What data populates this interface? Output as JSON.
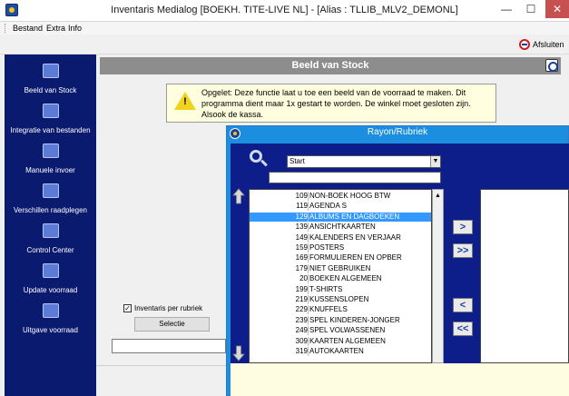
{
  "window": {
    "title": "Inventaris Medialog [BOEKH. TITE-LIVE NL] - [Alias : TLLIB_MLV2_DEMONL]",
    "minimize": "—",
    "maximize": "☐",
    "close": "✕"
  },
  "menu": {
    "items": [
      "Bestand",
      "Extra",
      "Info"
    ]
  },
  "toolbar": {
    "afsluiten_label": "Afsluiten"
  },
  "sidebar": {
    "items": [
      {
        "label": "Beeld van Stock",
        "icon": "camera-icon"
      },
      {
        "label": "Integratie van bestanden",
        "icon": "import-icon"
      },
      {
        "label": "Manuele invoer",
        "icon": "keyboard-icon"
      },
      {
        "label": "Verschillen raadplegen",
        "icon": "compare-icon"
      },
      {
        "label": "Control Center",
        "icon": "control-center-icon"
      },
      {
        "label": "Update voorraad",
        "icon": "update-icon"
      },
      {
        "label": "Uitgave voorraad",
        "icon": "print-icon"
      }
    ]
  },
  "panel": {
    "title": "Beeld van Stock",
    "warning_text": "Opgelet: Deze functie laat u toe een beeld van de voorraad te maken. Dit programma dient maar 1x gestart te worden.  De winkel moet gesloten zijn.  Alsook de kassa.",
    "checkbox_label": "Inventaris per rubriek",
    "checkbox_checked": true,
    "checkbox_mark": "✓",
    "selectie_label": "Selectie"
  },
  "dialog": {
    "title": "Rayon/Rubriek",
    "dropdown_value": "Start",
    "dropdown_arrow": "▼",
    "search_value": "",
    "move_right": ">",
    "move_all_right": ">>",
    "move_left": "<",
    "move_all_left": "<<",
    "arrow_up": "⬆",
    "arrow_down": "⬇",
    "list": [
      {
        "code": "109",
        "name": "NON-BOEK HOOG BTW",
        "selected": false
      },
      {
        "code": "119",
        "name": "AGENDA S",
        "selected": false
      },
      {
        "code": "129",
        "name": "ALBUMS EN DAGBOEKEN",
        "selected": true
      },
      {
        "code": "139",
        "name": "ANSICHTKAARTEN",
        "selected": false
      },
      {
        "code": "149",
        "name": "KALENDERS EN VERJAAR",
        "selected": false
      },
      {
        "code": "159",
        "name": "POSTERS",
        "selected": false
      },
      {
        "code": "169",
        "name": "FORMULIEREN EN OPBER",
        "selected": false
      },
      {
        "code": "179",
        "name": "NIET GEBRUIKEN",
        "selected": false
      },
      {
        "code": "20",
        "name": "BOEKEN ALGEMEEN",
        "selected": false
      },
      {
        "code": "199",
        "name": "T-SHIRTS",
        "selected": false
      },
      {
        "code": "219",
        "name": "KUSSENSLOPEN",
        "selected": false
      },
      {
        "code": "229",
        "name": "KNUFFELS",
        "selected": false
      },
      {
        "code": "239",
        "name": "SPEL KINDEREN-JONGER",
        "selected": false
      },
      {
        "code": "249",
        "name": "SPEL VOLWASSENEN",
        "selected": false
      },
      {
        "code": "309",
        "name": "KAARTEN ALGEMEEN",
        "selected": false
      },
      {
        "code": "319",
        "name": "AUTOKAARTEN",
        "selected": false
      }
    ]
  },
  "colors": {
    "sidebar_bg": "#0a1a6e",
    "dialog_bg": "#1b8ee0",
    "dialog_inner": "#0d1e8a",
    "selection": "#3399ff",
    "warning_bg": "#ffffe0"
  }
}
